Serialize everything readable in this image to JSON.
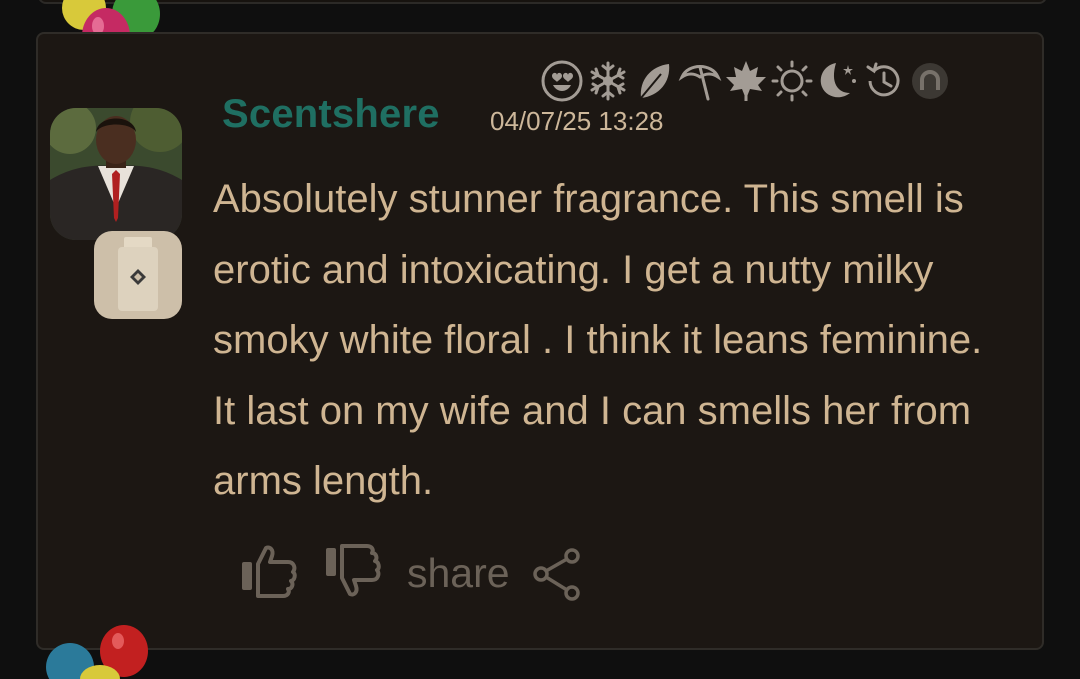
{
  "review": {
    "username": "Scentshere",
    "timestamp": "04/07/25 13:28",
    "text": "Absolutely stunner fragrance. This smell is erotic and intoxicating. I get a nutty milky smoky white floral . I think it leans feminine. It last on my wife and I can smells her from arms length."
  },
  "season_icons": [
    "love-icon",
    "winter-icon",
    "spring-icon",
    "summer-icon",
    "autumn-icon",
    "day-icon",
    "night-icon",
    "longevity-icon",
    "sillage-icon"
  ],
  "actions": {
    "share_label": "share"
  },
  "colors": {
    "background": "#0f0f0f",
    "card": "#1c1713",
    "username": "#1f6f62",
    "text": "#cfb592",
    "muted": "#6b6258"
  }
}
